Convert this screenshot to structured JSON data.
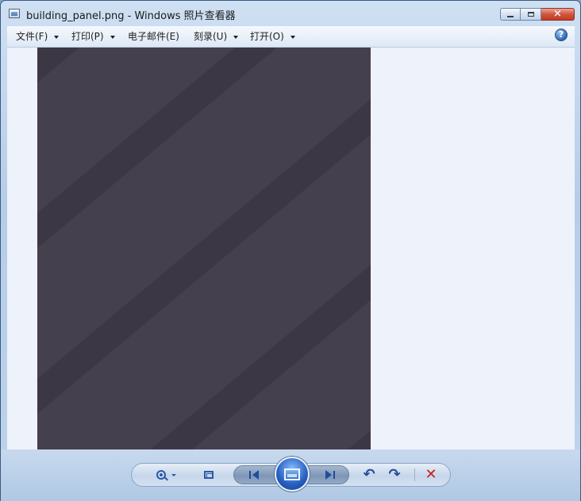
{
  "window": {
    "title": "building_panel.png - Windows 照片查看器"
  },
  "menu": {
    "items": [
      {
        "label": "文件(F)"
      },
      {
        "label": "打印(P)"
      },
      {
        "label": "电子邮件(E)"
      },
      {
        "label": "刻录(U)"
      },
      {
        "label": "打开(O)"
      }
    ],
    "help_label": "?"
  },
  "colors": {
    "photo_background": "#45404d",
    "photo_stripe": "#3b3744",
    "viewer_background": "#eef2fa"
  },
  "toolbar": {
    "icons": [
      "zoom-icon",
      "fit-to-window-icon",
      "previous-icon",
      "slideshow-icon",
      "next-icon",
      "rotate-counterclockwise-icon",
      "rotate-clockwise-icon",
      "delete-icon"
    ]
  }
}
